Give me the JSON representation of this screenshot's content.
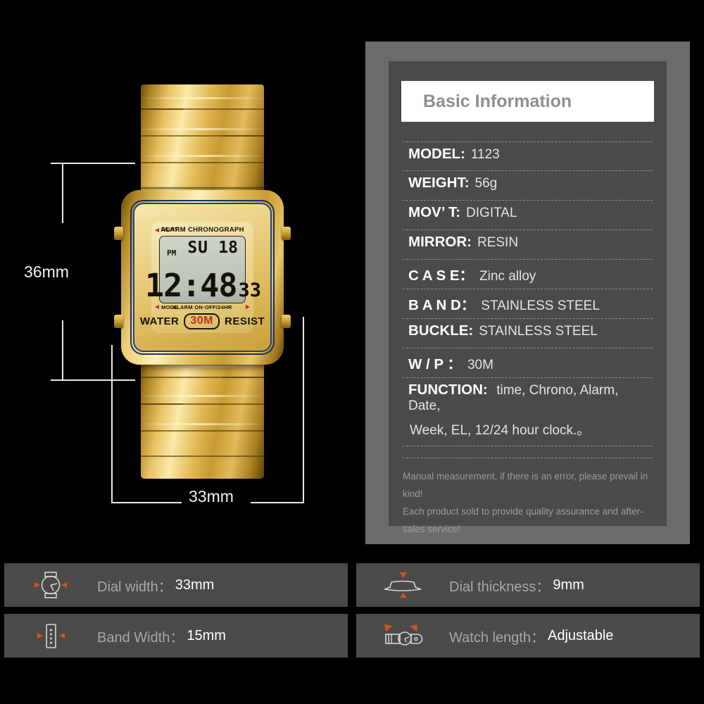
{
  "product": {
    "dimensions": {
      "height_label": "36mm",
      "width_label": "33mm"
    },
    "watch_face": {
      "brand_line": "ALARM CHRONOGRAPH",
      "light_label": "LIGHT",
      "mode_label": "MODE",
      "alarm_switch_label": "ALARM ON·OFF/24HR",
      "water_left": "WATER",
      "water_rating": "30M",
      "water_right": "RESIST",
      "lcd": {
        "meridiem": "PM",
        "weekday": "SU",
        "date": "18",
        "time": "12:48",
        "seconds": "33"
      }
    }
  },
  "spec_panel": {
    "header": "Basic Information",
    "rows": [
      {
        "key": "MODEL:",
        "value": "1123"
      },
      {
        "key": "WEIGHT:",
        "value": "56g"
      },
      {
        "key": "MOV’ T:",
        "value": "DIGITAL"
      },
      {
        "key": "MIRROR:",
        "value": "RESIN"
      },
      {
        "key": "C A S E：",
        "value": "Zinc alloy"
      },
      {
        "key": "B A N D：",
        "value": "STAINLESS STEEL"
      },
      {
        "key": "BUCKLE:",
        "value": "STAINLESS STEEL"
      },
      {
        "key": "W / P ：",
        "value": "30M"
      }
    ],
    "function_row": {
      "key": "FUNCTION:",
      "line1": "time, Chrono, Alarm, Date,",
      "line2": "Week, EL, 12/24 hour clock.。"
    },
    "notes": [
      "Manual measurement, if there is an error, please prevail in kind!",
      "Each product sold to provide quality assurance and after-sales service!"
    ]
  },
  "feature_tiles": [
    {
      "icon": "watch-dial-width-icon",
      "label": "Dial width：",
      "value": "33mm"
    },
    {
      "icon": "watch-thickness-icon",
      "label": "Dial thickness：",
      "value": "9mm"
    },
    {
      "icon": "watch-band-width-icon",
      "label": "Band Width：",
      "value": "15mm"
    },
    {
      "icon": "watch-length-icon",
      "label": "Watch length：",
      "value": "Adjustable"
    }
  ],
  "colors": {
    "background": "#000000",
    "panel_outer": "#6b6b6b",
    "panel_inner": "#4a4a4a",
    "accent_orange": "#d1541f",
    "header_bg": "#ffffff",
    "header_text": "#8f8f8f"
  }
}
